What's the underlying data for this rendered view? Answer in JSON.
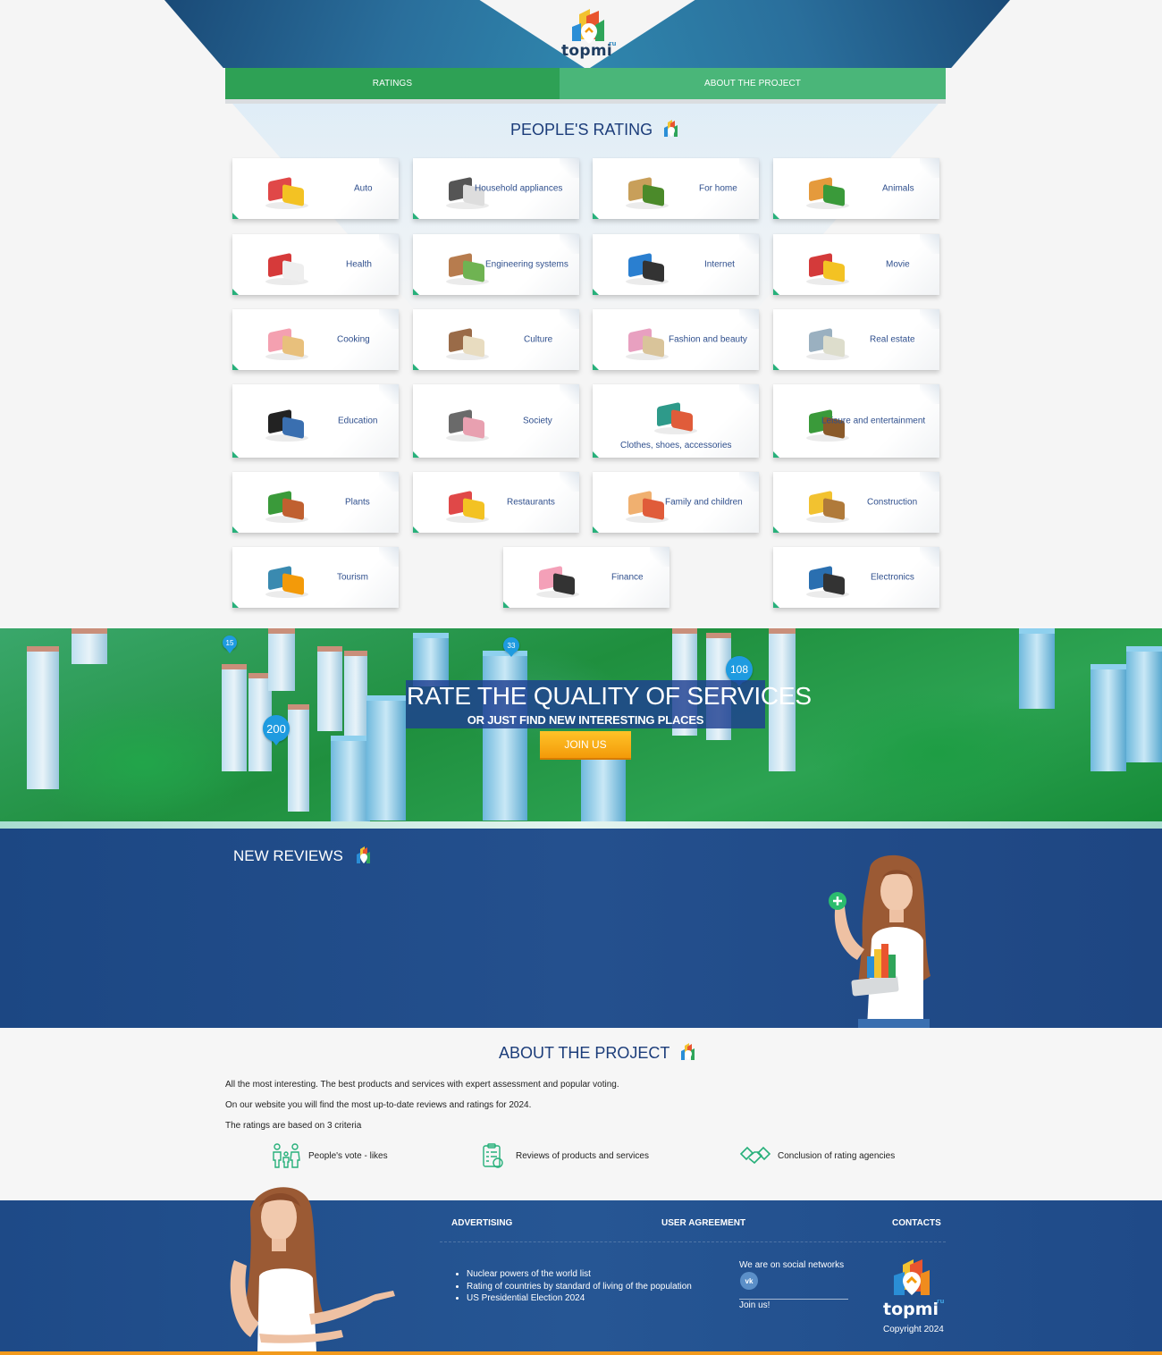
{
  "brand": {
    "name": "topmi",
    "tld": "ru"
  },
  "nav": {
    "tabs": [
      {
        "label": "RATINGS",
        "active": true
      },
      {
        "label": "ABOUT THE PROJECT",
        "active": false
      }
    ]
  },
  "ratings": {
    "title": "PEOPLE'S RATING",
    "categories": [
      {
        "label": "Auto",
        "icon": "cars-icon"
      },
      {
        "label": "Household appliances",
        "icon": "appliances-icon"
      },
      {
        "label": "For home",
        "icon": "house-icon"
      },
      {
        "label": "Animals",
        "icon": "cat-icon"
      },
      {
        "label": "Health",
        "icon": "medical-kit-icon"
      },
      {
        "label": "Engineering systems",
        "icon": "house-cutaway-icon"
      },
      {
        "label": "Internet",
        "icon": "laptop-globe-icon"
      },
      {
        "label": "Movie",
        "icon": "popcorn-icon"
      },
      {
        "label": "Cooking",
        "icon": "cupcake-icon"
      },
      {
        "label": "Culture",
        "icon": "books-icon"
      },
      {
        "label": "Fashion and beauty",
        "icon": "spa-icon"
      },
      {
        "label": "Real estate",
        "icon": "building-icon"
      },
      {
        "label": "Education",
        "icon": "graduation-cap-icon"
      },
      {
        "label": "Society",
        "icon": "family-icon"
      },
      {
        "label": "Clothes, shoes, accessories",
        "icon": "bag-shoes-icon"
      },
      {
        "label": "Leisure and entertainment",
        "icon": "palm-island-icon"
      },
      {
        "label": "Plants",
        "icon": "potted-plants-icon"
      },
      {
        "label": "Restaurants",
        "icon": "salad-plate-icon"
      },
      {
        "label": "Family and children",
        "icon": "children-icon"
      },
      {
        "label": "Construction",
        "icon": "hard-hat-icon"
      },
      {
        "label": "Tourism",
        "icon": "backpack-icon"
      },
      {
        "label": "Finance",
        "icon": "piggy-bank-icon"
      },
      {
        "label": "Electronics",
        "icon": "electronics-icon"
      }
    ]
  },
  "banner": {
    "title": "RATE THE QUALITY OF SERVICES",
    "subtitle": "OR JUST FIND NEW INTERESTING PLACES",
    "button": "JOIN US",
    "pins": [
      "15",
      "33",
      "108",
      "200"
    ]
  },
  "reviews": {
    "title": "NEW REVIEWS"
  },
  "about": {
    "title": "ABOUT THE PROJECT",
    "paragraphs": [
      "All the most interesting. The best products and services with expert assessment and popular voting.",
      "On our website you will find the most up-to-date reviews and ratings for 2024.",
      "The ratings are based on 3 criteria"
    ],
    "criteria": [
      {
        "label": "People's vote - likes",
        "icon": "people-icon"
      },
      {
        "label": "Reviews of products and services",
        "icon": "clipboard-icon"
      },
      {
        "label": "Conclusion of rating agencies",
        "icon": "handshake-icon"
      }
    ]
  },
  "footer": {
    "links": [
      "ADVERTISING",
      "USER AGREEMENT",
      "CONTACTS"
    ],
    "list": [
      "Nuclear powers of the world list",
      "Rating of countries by standard of living of the population",
      "US Presidential Election 2024"
    ],
    "social_label": "We are on social networks",
    "vk": "vk",
    "join": "Join us!",
    "copyright": "Copyright 2024"
  },
  "colors": {
    "nav_active": "#2ea155",
    "nav_inactive": "#4ab679",
    "title_blue": "#1c3d7a",
    "footer_blue": "#265694",
    "accent_orange": "#f39a09",
    "card_corner": "#27b07a"
  }
}
